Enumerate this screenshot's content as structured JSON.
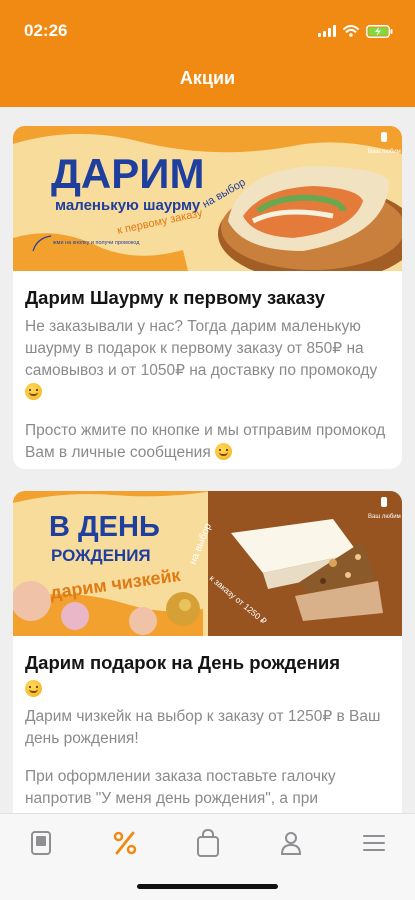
{
  "status_bar": {
    "time": "02:26"
  },
  "header": {
    "title": "Акции"
  },
  "colors": {
    "accent": "#f08a13",
    "banner_blue": "#1f3f9e",
    "text_gray": "#8a8a8a"
  },
  "promos": [
    {
      "banner": {
        "headline": "ДАРИМ",
        "subheadline": "маленькую шаурму",
        "tag_first_order": "к первому заказу",
        "tag_choice": "на выбор",
        "hint": "жми на кнопку и получи промокод",
        "logo_text": "Ваш любим"
      },
      "title": "Дарим Шаурму к первому заказу",
      "paragraph1": "Не заказывали у нас? Тогда дарим маленькую шаурму в подарок к первому заказу от 850₽ на самовывоз и от 1050₽ на доставку по промокоду",
      "paragraph2": "Просто жмите по кнопке и мы отправим промокод Вам в личные сообщения"
    },
    {
      "banner": {
        "headline": "В ДЕНЬ",
        "subheadline": "РОЖДЕНИЯ",
        "tag_gift": "дарим чизкейк",
        "tag_choice": "на выбор",
        "tag_order": "к заказу от 1250 ₽",
        "logo_text": "Ваш любим"
      },
      "title": "Дарим подарок на День рождения",
      "paragraph1": "Дарим чизкейк на выбор к заказу от 1250₽ в Ваш день рождения!",
      "paragraph2": "При оформлении заказа поставьте галочку напротив \"У меня день рождения\", а при получении заказа покажите курьеру паспорт"
    }
  ],
  "tabbar": {
    "items": [
      {
        "icon": "menu-card-icon",
        "active": false
      },
      {
        "icon": "percent-icon",
        "active": true
      },
      {
        "icon": "bag-icon",
        "active": false
      },
      {
        "icon": "profile-icon",
        "active": false
      },
      {
        "icon": "hamburger-icon",
        "active": false
      }
    ]
  }
}
